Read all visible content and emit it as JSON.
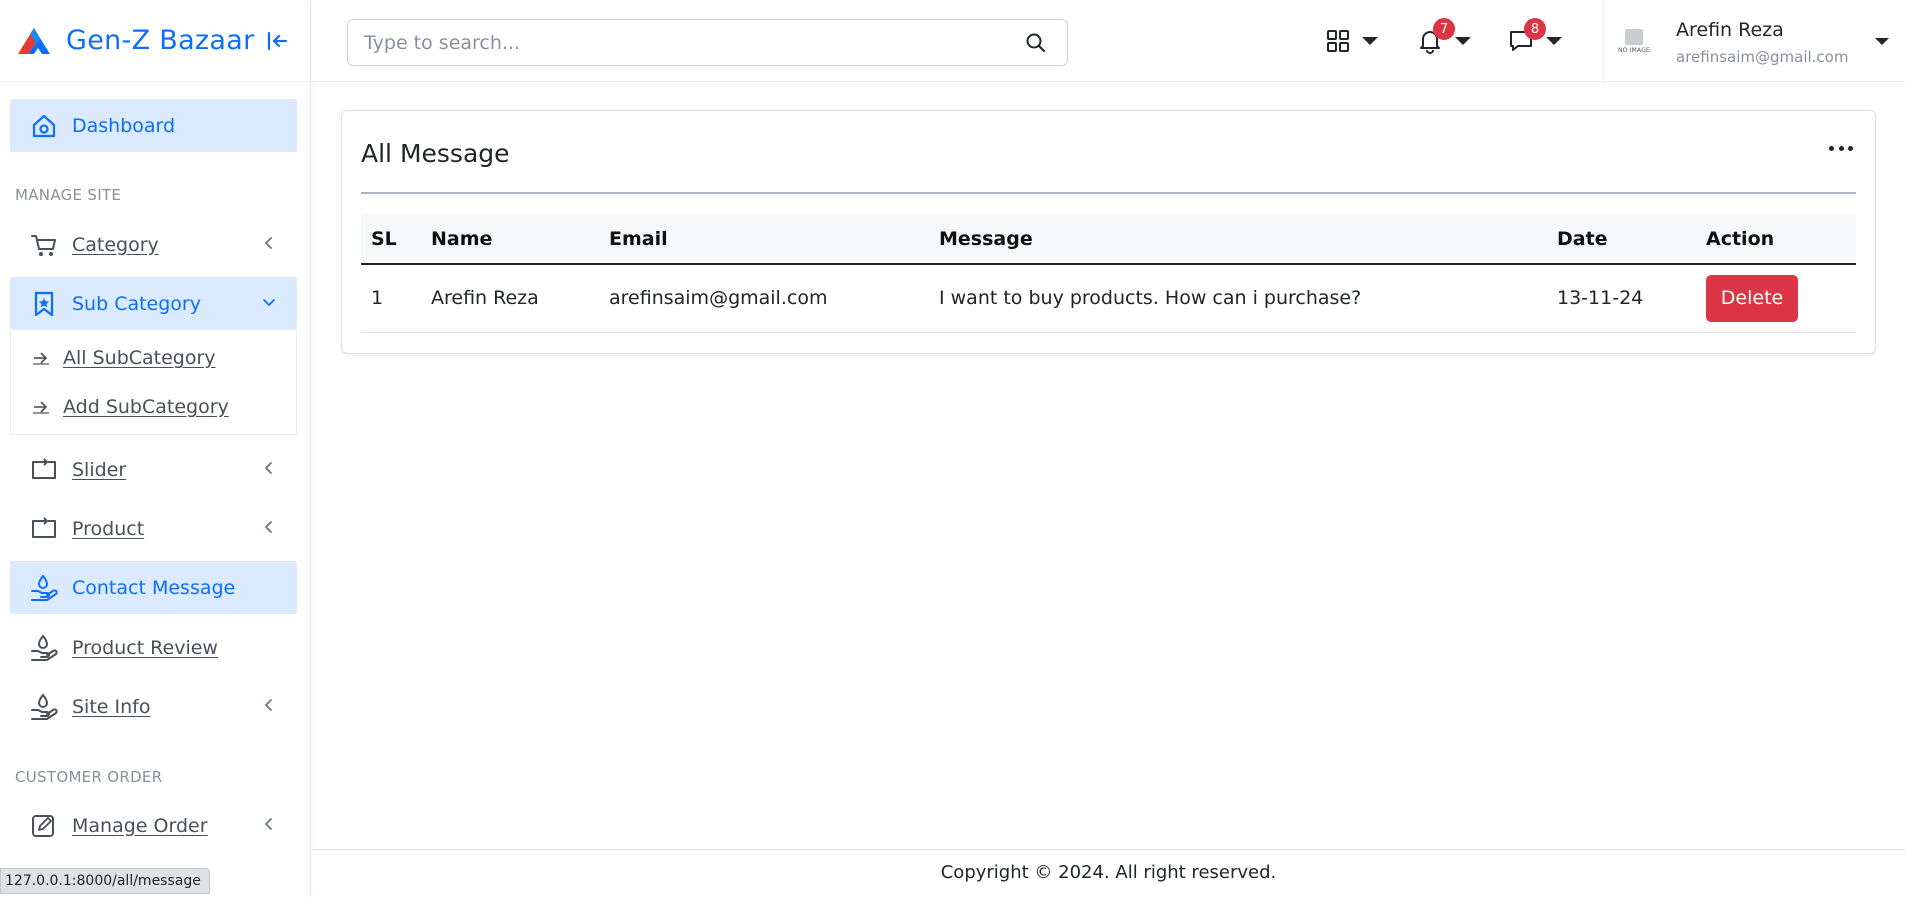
{
  "brand": {
    "name": "Gen-Z Bazaar"
  },
  "sidebar": {
    "dashboard": "Dashboard",
    "section_manage_site": "MANAGE SITE",
    "category": "Category",
    "sub_category": "Sub Category",
    "sub_items": [
      "All SubCategory",
      "Add SubCategory"
    ],
    "slider": "Slider",
    "product": "Product",
    "contact_message": "Contact Message",
    "product_review": "Product Review",
    "site_info": "Site Info",
    "section_customer_order": "CUSTOMER ORDER",
    "manage_order": "Manage Order"
  },
  "topbar": {
    "search_placeholder": "Type to search...",
    "notifications_count": "7",
    "messages_count": "8",
    "user": {
      "avatar_text": "NO IMAGE",
      "name": "Arefin Reza",
      "email": "arefinsaim@gmail.com"
    }
  },
  "main": {
    "card_title": "All Message",
    "columns": [
      "SL",
      "Name",
      "Email",
      "Message",
      "Date",
      "Action"
    ],
    "rows": [
      {
        "sl": "1",
        "name": "Arefin Reza",
        "email": "arefinsaim@gmail.com",
        "message": "I want to buy products. How can i purchase?",
        "date": "13-11-24",
        "action": "Delete"
      }
    ]
  },
  "footer": {
    "copyright": "Copyright © 2024. All right reserved."
  },
  "status_url": "127.0.0.1:8000/all/message",
  "colors": {
    "primary": "#0d6efd",
    "active_bg": "#dbeafe",
    "danger": "#dc3545"
  }
}
